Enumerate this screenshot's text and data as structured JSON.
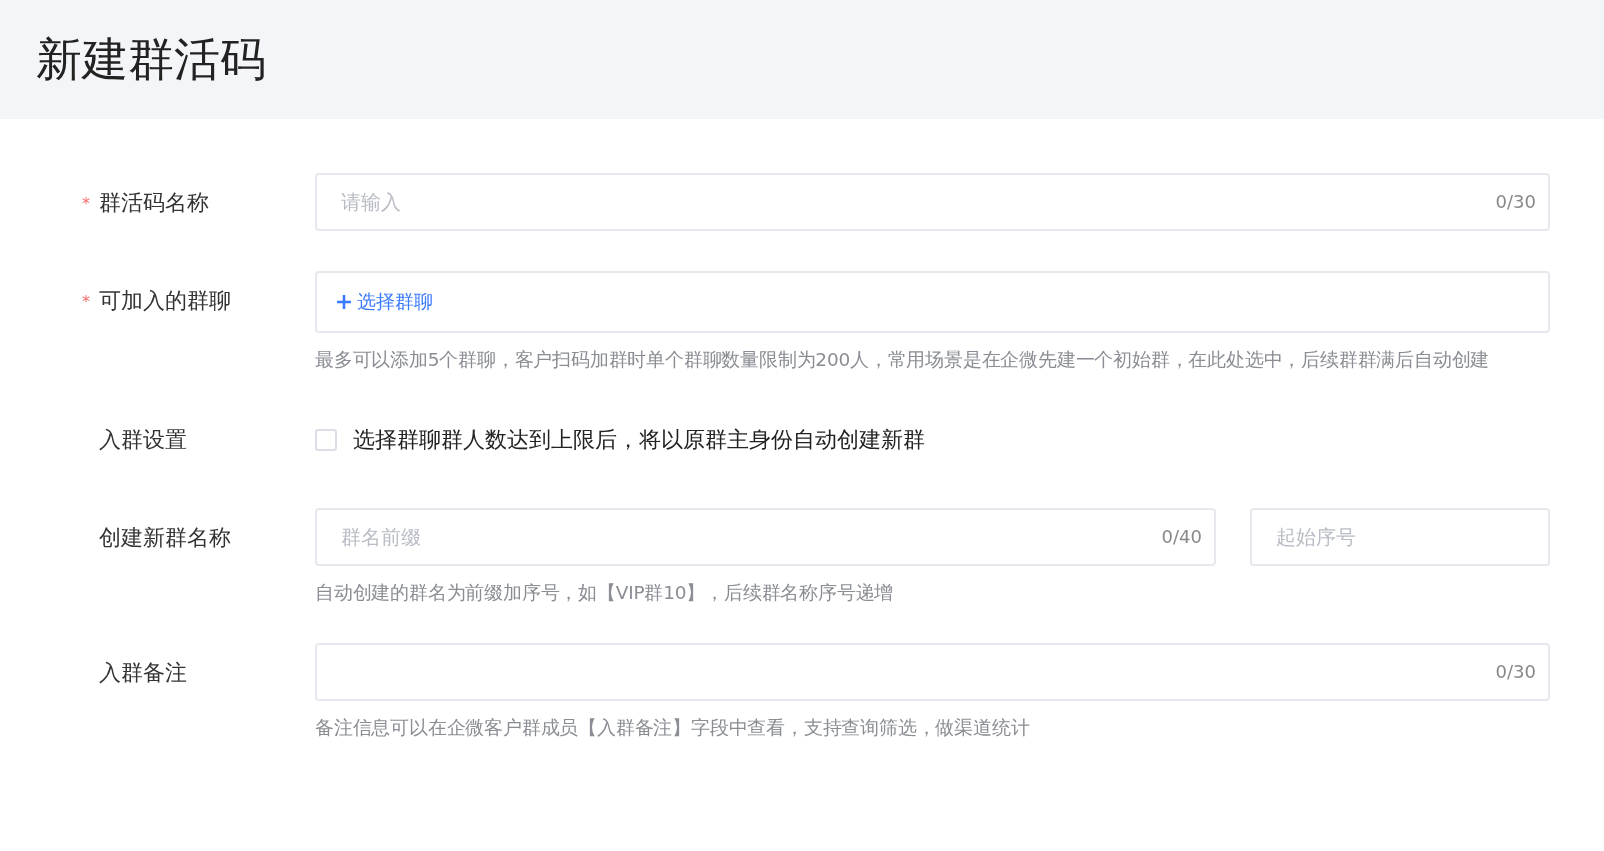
{
  "page": {
    "title": "新建群活码"
  },
  "form": {
    "rows": [
      {
        "kind": "text",
        "label": "群活码名称",
        "required_mark": "*",
        "placeholder": "请输入",
        "counter": "0/30"
      },
      {
        "kind": "picker",
        "label": "可加入的群聊",
        "required_mark": "*",
        "action": "选择群聊",
        "hint": "最多可以添加5个群聊，客户扫码加群时单个群聊数量限制为200人，常用场景是在企微先建一个初始群，在此处选中，后续群群满后自动创建"
      },
      {
        "kind": "checkbox",
        "label": "入群设置",
        "checked": false,
        "option": "选择群聊群人数达到上限后，将以原群主身份自动创建新群"
      },
      {
        "kind": "split",
        "label": "创建新群名称",
        "placeholder": "群名前缀",
        "counter": "0/40",
        "second_placeholder": "起始序号",
        "hint": "自动创建的群名为前缀加序号，如【VIP群10】，后续群名称序号递增"
      },
      {
        "kind": "text",
        "label": "入群备注",
        "counter": "0/30",
        "hint": "备注信息可以在企微客户群成员【入群备注】字段中查看，支持查询筛选，做渠道统计"
      }
    ]
  }
}
